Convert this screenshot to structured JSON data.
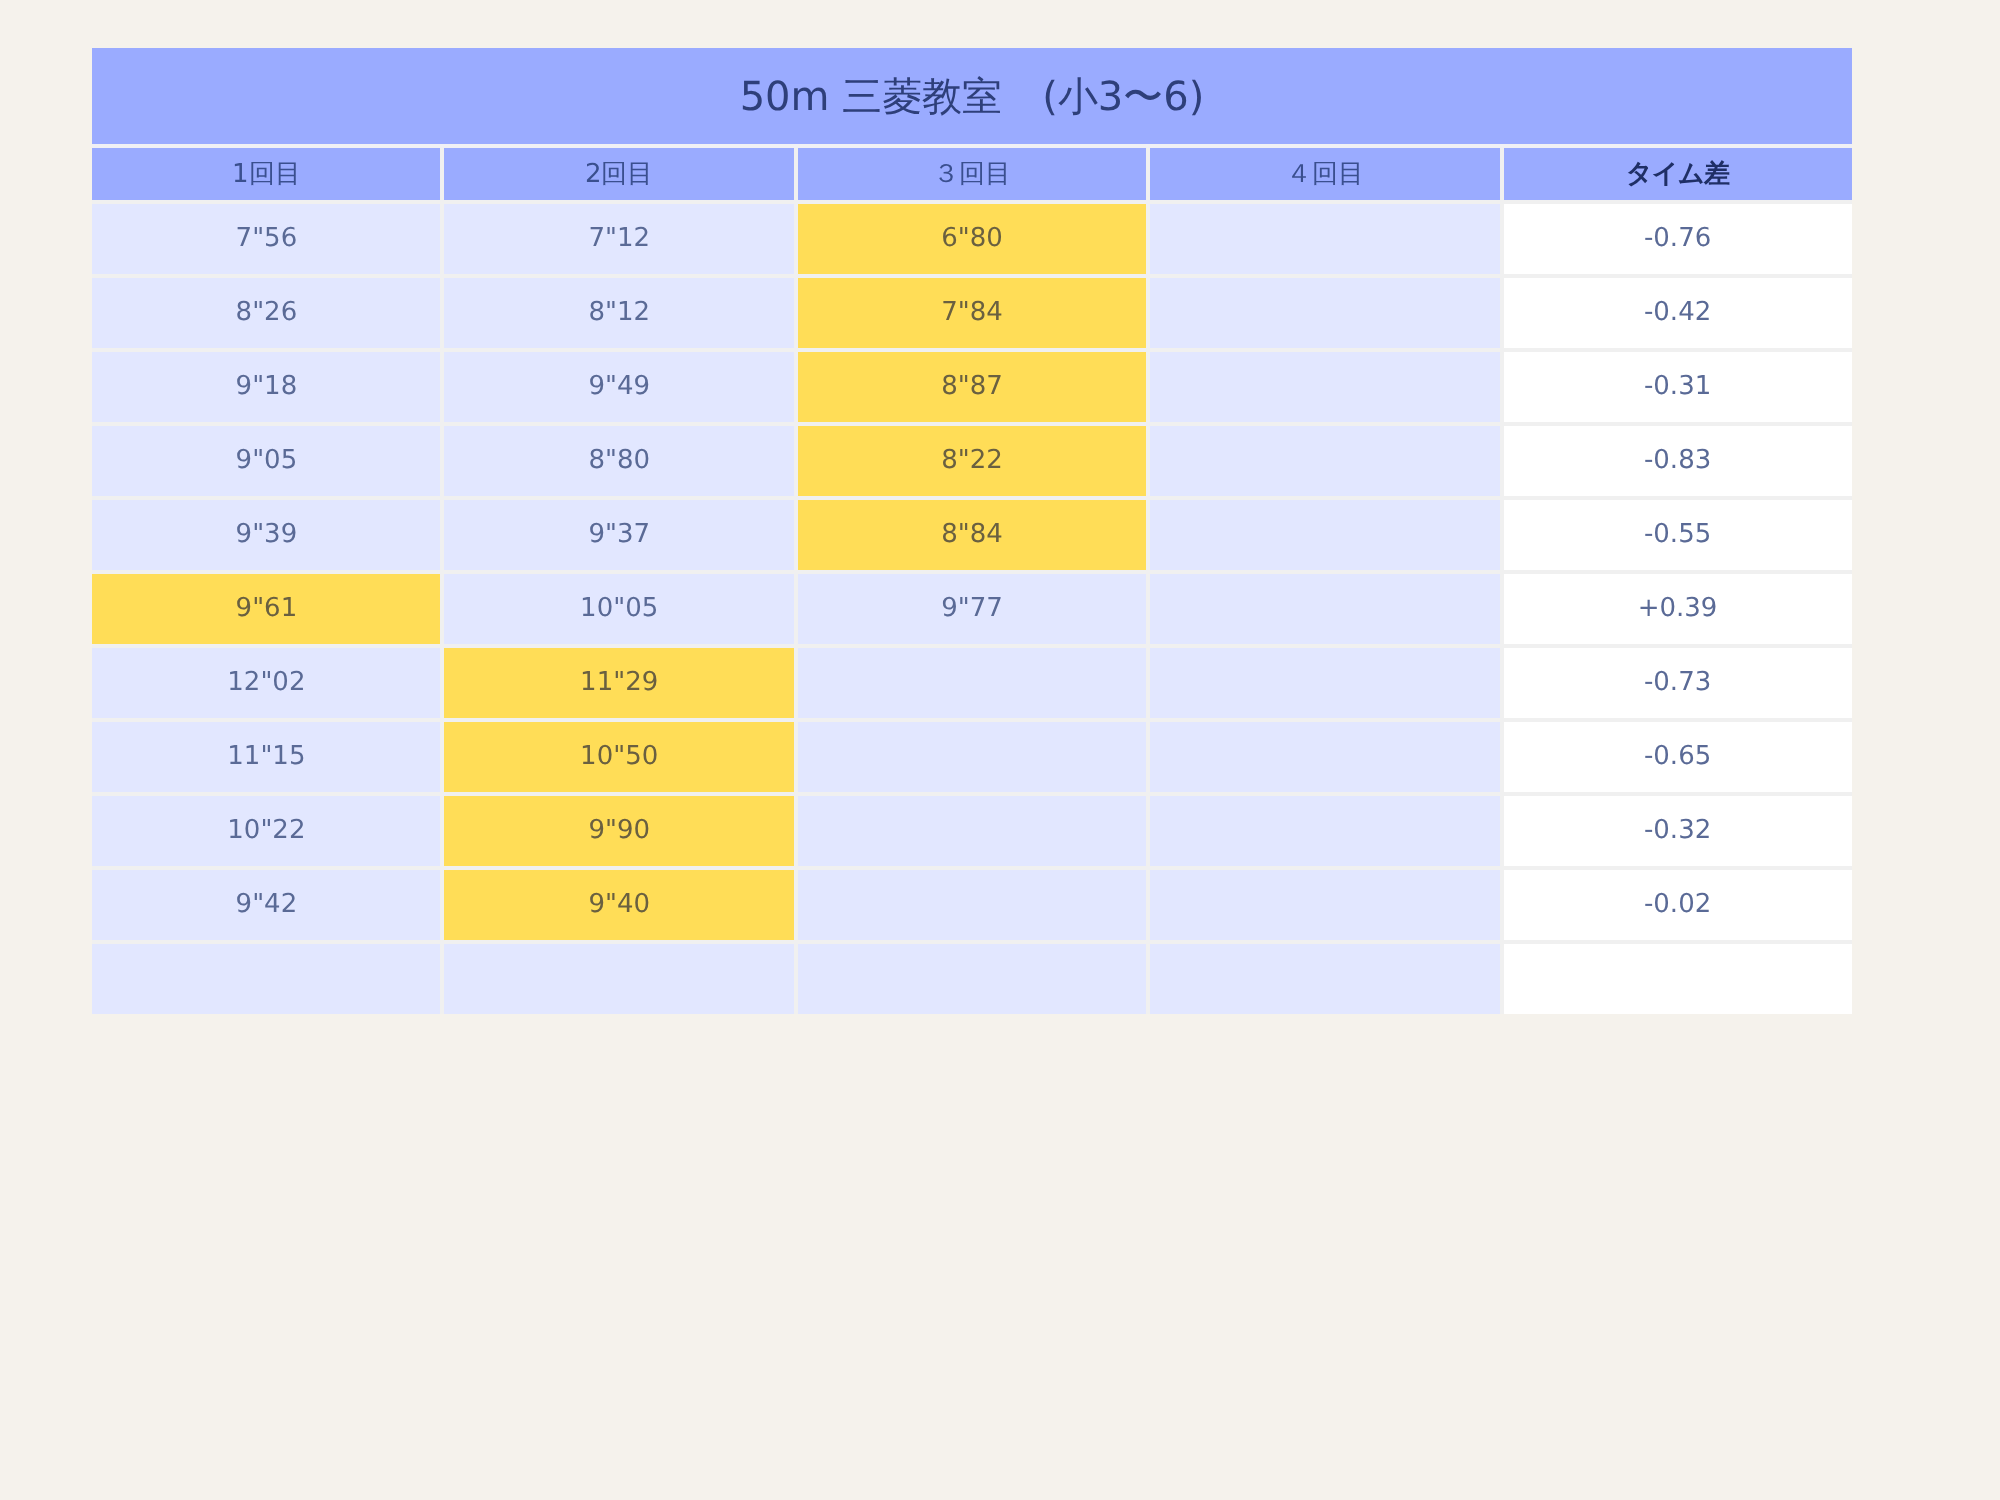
{
  "title": "50m 三菱教室　(小3〜6)",
  "columns": [
    "1回目",
    "2回目",
    "３回目",
    "４回目",
    "タイム差"
  ],
  "rows": [
    {
      "cells": [
        {
          "text": "7\"56",
          "highlighted": false
        },
        {
          "text": "7\"12",
          "highlighted": false
        },
        {
          "text": "6\"80",
          "highlighted": true
        },
        {
          "highlighted": false
        }
      ],
      "diff": "-0.76"
    },
    {
      "cells": [
        {
          "text": "8\"26",
          "highlighted": false
        },
        {
          "text": "8\"12",
          "highlighted": false
        },
        {
          "text": "7\"84",
          "highlighted": true
        },
        {
          "highlighted": false
        }
      ],
      "diff": "-0.42"
    },
    {
      "cells": [
        {
          "text": "9\"18",
          "highlighted": false
        },
        {
          "text": "9\"49",
          "highlighted": false
        },
        {
          "text": "8\"87",
          "highlighted": true
        },
        {
          "highlighted": false
        }
      ],
      "diff": "-0.31"
    },
    {
      "cells": [
        {
          "text": "9\"05",
          "highlighted": false
        },
        {
          "text": "8\"80",
          "highlighted": false
        },
        {
          "text": "8\"22",
          "highlighted": true
        },
        {
          "highlighted": false
        }
      ],
      "diff": "-0.83"
    },
    {
      "cells": [
        {
          "text": "9\"39",
          "highlighted": false
        },
        {
          "text": "9\"37",
          "highlighted": false
        },
        {
          "text": "8\"84",
          "highlighted": true
        },
        {
          "highlighted": false
        }
      ],
      "diff": "-0.55"
    },
    {
      "cells": [
        {
          "text": "9\"61",
          "highlighted": true
        },
        {
          "text": "10\"05",
          "highlighted": false
        },
        {
          "text": "9\"77",
          "highlighted": false
        },
        {
          "highlighted": false
        }
      ],
      "diff": "+0.39"
    },
    {
      "cells": [
        {
          "text": "12\"02",
          "highlighted": false
        },
        {
          "text": "11\"29",
          "highlighted": true
        },
        {
          "highlighted": false
        },
        {
          "highlighted": false
        }
      ],
      "diff": "-0.73"
    },
    {
      "cells": [
        {
          "text": "11\"15",
          "highlighted": false
        },
        {
          "text": "10\"50",
          "highlighted": true
        },
        {
          "highlighted": false
        },
        {
          "highlighted": false
        }
      ],
      "diff": "-0.65"
    },
    {
      "cells": [
        {
          "text": "10\"22",
          "highlighted": false
        },
        {
          "text": "9\"90",
          "highlighted": true
        },
        {
          "highlighted": false
        },
        {
          "highlighted": false
        }
      ],
      "diff": "-0.32"
    },
    {
      "cells": [
        {
          "text": "9\"42",
          "highlighted": false
        },
        {
          "text": "9\"40",
          "highlighted": true
        },
        {
          "highlighted": false
        },
        {
          "highlighted": false
        }
      ],
      "diff": "-0.02"
    },
    {
      "cells": [
        {
          "highlighted": false
        },
        {
          "highlighted": false
        },
        {
          "highlighted": false
        },
        {
          "highlighted": false
        }
      ]
    }
  ]
}
